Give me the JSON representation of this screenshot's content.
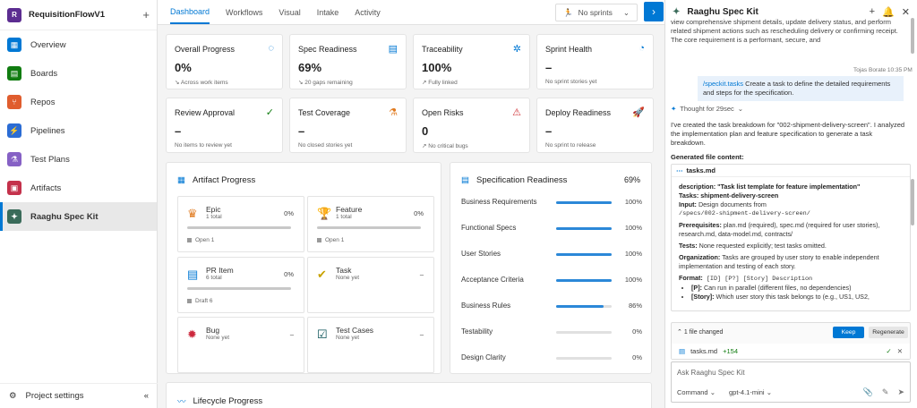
{
  "project": {
    "avatar": "R",
    "name": "RequisitionFlowV1",
    "add": "+"
  },
  "nav": [
    {
      "label": "Overview",
      "icon": "overview-icon",
      "color": "#0078d4",
      "glyph": "▦"
    },
    {
      "label": "Boards",
      "icon": "boards-icon",
      "color": "#107c10",
      "glyph": "▤"
    },
    {
      "label": "Repos",
      "icon": "repos-icon",
      "color": "#e05d2e",
      "glyph": "⑂"
    },
    {
      "label": "Pipelines",
      "icon": "pipelines-icon",
      "color": "#2b6cd4",
      "glyph": "⚡"
    },
    {
      "label": "Test Plans",
      "icon": "test-plans-icon",
      "color": "#8661c5",
      "glyph": "⚗"
    },
    {
      "label": "Artifacts",
      "icon": "artifacts-icon",
      "color": "#c4314b",
      "glyph": "▣"
    },
    {
      "label": "Raaghu Spec Kit",
      "icon": "spec-kit-icon",
      "color": "#3a6b5a",
      "glyph": "✦"
    }
  ],
  "settings": {
    "label": "Project settings",
    "collapse": "«"
  },
  "tabs": [
    "Dashboard",
    "Workflows",
    "Visual",
    "Intake",
    "Activity"
  ],
  "sprint": {
    "label": "No sprints"
  },
  "expand": "›",
  "kpis": [
    {
      "title": "Overall Progress",
      "value": "0%",
      "sub": "↘ Across work items",
      "icon": "progress-ring-icon",
      "glyph": "◌",
      "color": "#0078d4"
    },
    {
      "title": "Spec Readiness",
      "value": "69%",
      "sub": "↘ 20 gaps remaining",
      "icon": "spec-icon",
      "glyph": "▤",
      "color": "#0078d4"
    },
    {
      "title": "Traceability",
      "value": "100%",
      "sub": "↗ Fully linked",
      "icon": "network-icon",
      "glyph": "✲",
      "color": "#0078d4"
    },
    {
      "title": "Sprint Health",
      "value": "–",
      "sub": "No sprint stories yet",
      "icon": "gauge-icon",
      "glyph": "◔",
      "color": "#0078d4"
    },
    {
      "title": "Review Approval",
      "value": "–",
      "sub": "No items to review yet",
      "icon": "check-circle-icon",
      "glyph": "✓",
      "color": "#107c10"
    },
    {
      "title": "Test Coverage",
      "value": "–",
      "sub": "No closed stories yet",
      "icon": "flask-icon",
      "glyph": "⚗",
      "color": "#e07a1f"
    },
    {
      "title": "Open Risks",
      "value": "0",
      "sub": "↗ No critical bugs",
      "icon": "warning-icon",
      "glyph": "⚠",
      "color": "#d13438"
    },
    {
      "title": "Deploy Readiness",
      "value": "–",
      "sub": "No sprint to release",
      "icon": "rocket-icon",
      "glyph": "🚀",
      "color": "#107c10"
    }
  ],
  "artifact_progress": {
    "title": "Artifact Progress",
    "items": [
      {
        "name": "Epic",
        "count": "1 total",
        "pct": "0%",
        "status": "Open 1",
        "icon": "epic-crown-icon",
        "glyph": "♛",
        "color": "#e07a1f",
        "has_bar": true
      },
      {
        "name": "Feature",
        "count": "1 total",
        "pct": "0%",
        "status": "Open 1",
        "icon": "feature-trophy-icon",
        "glyph": "🏆",
        "color": "#773b93",
        "has_bar": true
      },
      {
        "name": "PR Item",
        "count": "6 total",
        "pct": "0%",
        "status": "Draft 6",
        "icon": "pr-item-icon",
        "glyph": "▤",
        "color": "#0078d4",
        "has_bar": true
      },
      {
        "name": "Task",
        "count": "None yet",
        "pct": "–",
        "status": "",
        "icon": "task-icon",
        "glyph": "✔",
        "color": "#c8a200",
        "has_bar": false
      },
      {
        "name": "Bug",
        "count": "None yet",
        "pct": "–",
        "status": "",
        "icon": "bug-icon",
        "glyph": "✹",
        "color": "#cc293d",
        "has_bar": false
      },
      {
        "name": "Test Cases",
        "count": "None yet",
        "pct": "–",
        "status": "",
        "icon": "test-cases-icon",
        "glyph": "☑",
        "color": "#004b50",
        "has_bar": false
      }
    ]
  },
  "spec_readiness": {
    "title": "Specification Readiness",
    "total": "69%",
    "rows": [
      {
        "label": "Business Requirements",
        "pct": "100%",
        "value": 100
      },
      {
        "label": "Functional Specs",
        "pct": "100%",
        "value": 100
      },
      {
        "label": "User Stories",
        "pct": "100%",
        "value": 100
      },
      {
        "label": "Acceptance Criteria",
        "pct": "100%",
        "value": 100
      },
      {
        "label": "Business Rules",
        "pct": "86%",
        "value": 86
      },
      {
        "label": "Testability",
        "pct": "0%",
        "value": 0
      },
      {
        "label": "Design Clarity",
        "pct": "0%",
        "value": 0
      }
    ]
  },
  "lifecycle": {
    "title": "Lifecycle Progress"
  },
  "chat": {
    "title": "Raaghu Spec Kit",
    "prev_text": "view comprehensive shipment details, update delivery status, and perform related shipment actions such as rescheduling delivery or confirming receipt. The core requirement is a performant, secure, and",
    "user_name": "Tojas Borate 10:35 PM",
    "user_cmd": "/speckit.tasks",
    "user_msg": " Create a task to define the detailed requirements and steps for the specification.",
    "thought": "Thought for 29sec",
    "reply": "I've created the task breakdown for \"002-shipment-delivery-screen\". I analyzed the implementation plan and feature specification to generate a task breakdown.",
    "generated_label": "Generated file content:",
    "file_name": "tasks.md",
    "file": {
      "desc_key": "description:",
      "desc_val": " \"Task list template for feature implementation\"",
      "tasks_line": "Tasks: shipment-delivery-screen",
      "input_key": "Input:",
      "input_val": " Design documents from",
      "input_path": "/specs/002-shipment-delivery-screen/",
      "prereq_key": "Prerequisites:",
      "prereq_val": " plan.md (required), spec.md (required for user stories), research.md, data-model.md, contracts/",
      "tests_key": "Tests:",
      "tests_val": " None requested explicitly; test tasks omitted.",
      "org_key": "Organization:",
      "org_val": " Tasks are grouped by user story to enable independent implementation and testing of each story.",
      "format_key": "Format:",
      "format_val": " [ID] [P?] [Story] Description",
      "b1_key": "[P]:",
      "b1_val": " Can run in parallel (different files, no dependencies)",
      "b2_key": "[Story]:",
      "b2_val": " Which user story this task belongs to (e.g., US1, US2,"
    },
    "changed": {
      "label": "1 file changed",
      "keep": "Keep",
      "regenerate": "Regenerate",
      "file": "tasks.md",
      "added": "+154"
    },
    "input": {
      "placeholder": "Ask Raaghu Spec Kit",
      "mode": "Command",
      "model": "gpt-4.1-mini"
    }
  }
}
